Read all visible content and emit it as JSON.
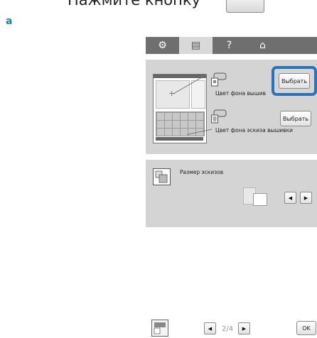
{
  "instruction": {
    "text": "Нажмите кнопку",
    "step_label": "a"
  },
  "tabs": [
    {
      "name": "settings",
      "icon": "settings-icon",
      "glyph": "⚙"
    },
    {
      "name": "document",
      "icon": "document-icon",
      "glyph": "▤"
    },
    {
      "name": "help",
      "icon": "help-icon",
      "glyph": "?"
    },
    {
      "name": "home",
      "icon": "home-icon",
      "glyph": "⌂"
    }
  ],
  "embroidery_background": {
    "label": "Цвет фона вышив",
    "select_label": "Выбрать"
  },
  "thumbnail_background": {
    "label": "Цвет фона эскиза вышивки",
    "select_label": "Выбрать"
  },
  "thumbnail_size": {
    "label": "Размер эскизов",
    "prev_glyph": "◀",
    "next_glyph": "▶"
  },
  "footer": {
    "page_current": "2",
    "page_total": "4",
    "prev_glyph": "◀",
    "next_glyph": "▶",
    "ok_label": "OK"
  },
  "colors": {
    "highlight": "#2a73b8",
    "tab_bar": "#6f6f6f",
    "panel": "#d4d4d4",
    "step_label": "#1a7fb5"
  }
}
